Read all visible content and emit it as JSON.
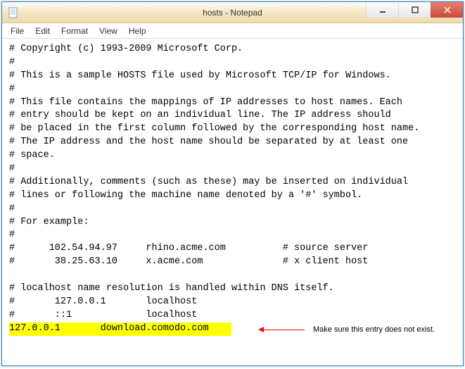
{
  "window": {
    "title": "hosts - Notepad"
  },
  "menu": {
    "file": "File",
    "edit": "Edit",
    "format": "Format",
    "view": "View",
    "help": "Help"
  },
  "content": {
    "lines": [
      "# Copyright (c) 1993-2009 Microsoft Corp.",
      "#",
      "# This is a sample HOSTS file used by Microsoft TCP/IP for Windows.",
      "#",
      "# This file contains the mappings of IP addresses to host names. Each",
      "# entry should be kept on an individual line. The IP address should",
      "# be placed in the first column followed by the corresponding host name.",
      "# The IP address and the host name should be separated by at least one",
      "# space.",
      "#",
      "# Additionally, comments (such as these) may be inserted on individual",
      "# lines or following the machine name denoted by a '#' symbol.",
      "#",
      "# For example:",
      "#",
      "#      102.54.94.97     rhino.acme.com          # source server",
      "#       38.25.63.10     x.acme.com              # x client host",
      "",
      "# localhost name resolution is handled within DNS itself.",
      "#       127.0.0.1       localhost",
      "#       ::1             localhost"
    ],
    "highlighted_line": "127.0.0.1       download.comodo.com    "
  },
  "annotation": {
    "text": "Make sure this entry does not exist."
  }
}
